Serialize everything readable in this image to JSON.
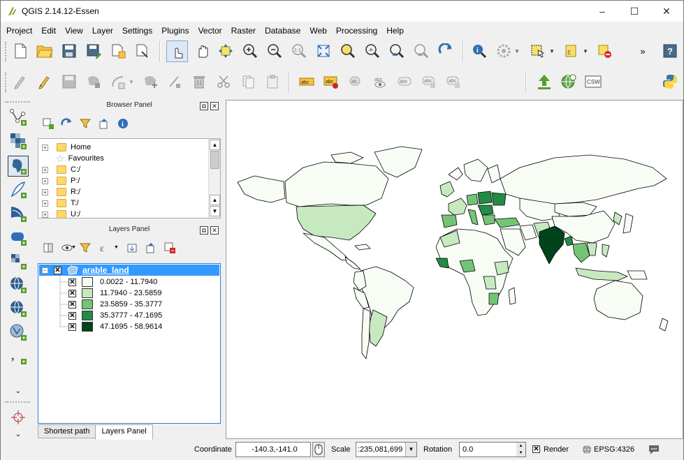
{
  "window": {
    "title": "QGIS 2.14.12-Essen",
    "minimize": "–",
    "maximize": "☐",
    "close": "✕"
  },
  "menu": [
    "Project",
    "Edit",
    "View",
    "Layer",
    "Settings",
    "Plugins",
    "Vector",
    "Raster",
    "Database",
    "Web",
    "Processing",
    "Help"
  ],
  "browser_panel": {
    "title": "Browser Panel",
    "items": [
      {
        "label": "Home",
        "type": "folder",
        "expandable": true
      },
      {
        "label": "Favourites",
        "type": "star",
        "expandable": false
      },
      {
        "label": "C:/",
        "type": "folder",
        "expandable": true
      },
      {
        "label": "P:/",
        "type": "folder",
        "expandable": true
      },
      {
        "label": "R:/",
        "type": "folder",
        "expandable": true
      },
      {
        "label": "T:/",
        "type": "folder",
        "expandable": true
      },
      {
        "label": "U:/",
        "type": "folder",
        "expandable": true
      }
    ]
  },
  "layers_panel": {
    "title": "Layers Panel",
    "layer": {
      "name": "arable_land",
      "checked": true
    },
    "classes": [
      {
        "label": "0.0022 - 11.7940",
        "color": "#f7fcf5"
      },
      {
        "label": "11.7940 - 23.5859",
        "color": "#c7e9c0"
      },
      {
        "label": "23.5859 - 35.3777",
        "color": "#74c476"
      },
      {
        "label": "35.3777 - 47.1695",
        "color": "#238b45"
      },
      {
        "label": "47.1695 - 58.9614",
        "color": "#00441b"
      }
    ]
  },
  "tabs": [
    {
      "label": "Shortest path",
      "active": false
    },
    {
      "label": "Layers Panel",
      "active": true
    }
  ],
  "status": {
    "coordinate_label": "Coordinate",
    "coordinate_value": "-140.3,-141.0",
    "scale_label": "Scale",
    "scale_value": ":235,081,699",
    "rotation_label": "Rotation",
    "rotation_value": "0.0",
    "render_label": "Render",
    "render_checked": true,
    "crs": "EPSG:4326"
  },
  "toolbar_more": "»",
  "colors": {
    "selection": "#3399ff",
    "layer_border": "#2a7fd4"
  }
}
